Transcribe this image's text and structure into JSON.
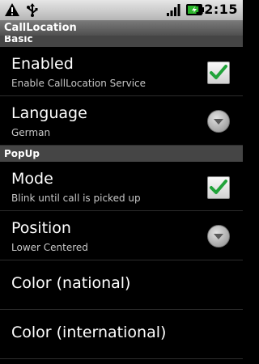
{
  "status_bar": {
    "time": "12:15",
    "battery_level": 0.9
  },
  "app_title": "CallLocation",
  "sections": {
    "basic": {
      "header": "Basic",
      "enabled": {
        "title": "Enabled",
        "summary": "Enable CallLocation Service",
        "checked": true
      },
      "language": {
        "title": "Language",
        "summary": "German"
      }
    },
    "popup": {
      "header": "PopUp",
      "mode": {
        "title": "Mode",
        "summary": "Blink until call is picked up",
        "checked": true
      },
      "position": {
        "title": "Position",
        "summary": "Lower Centered"
      },
      "color_national": {
        "title": "Color (national)"
      },
      "color_international": {
        "title": "Color (international)"
      }
    }
  },
  "colors": {
    "check_green": "#21a33a",
    "header_bg": "#454545"
  }
}
